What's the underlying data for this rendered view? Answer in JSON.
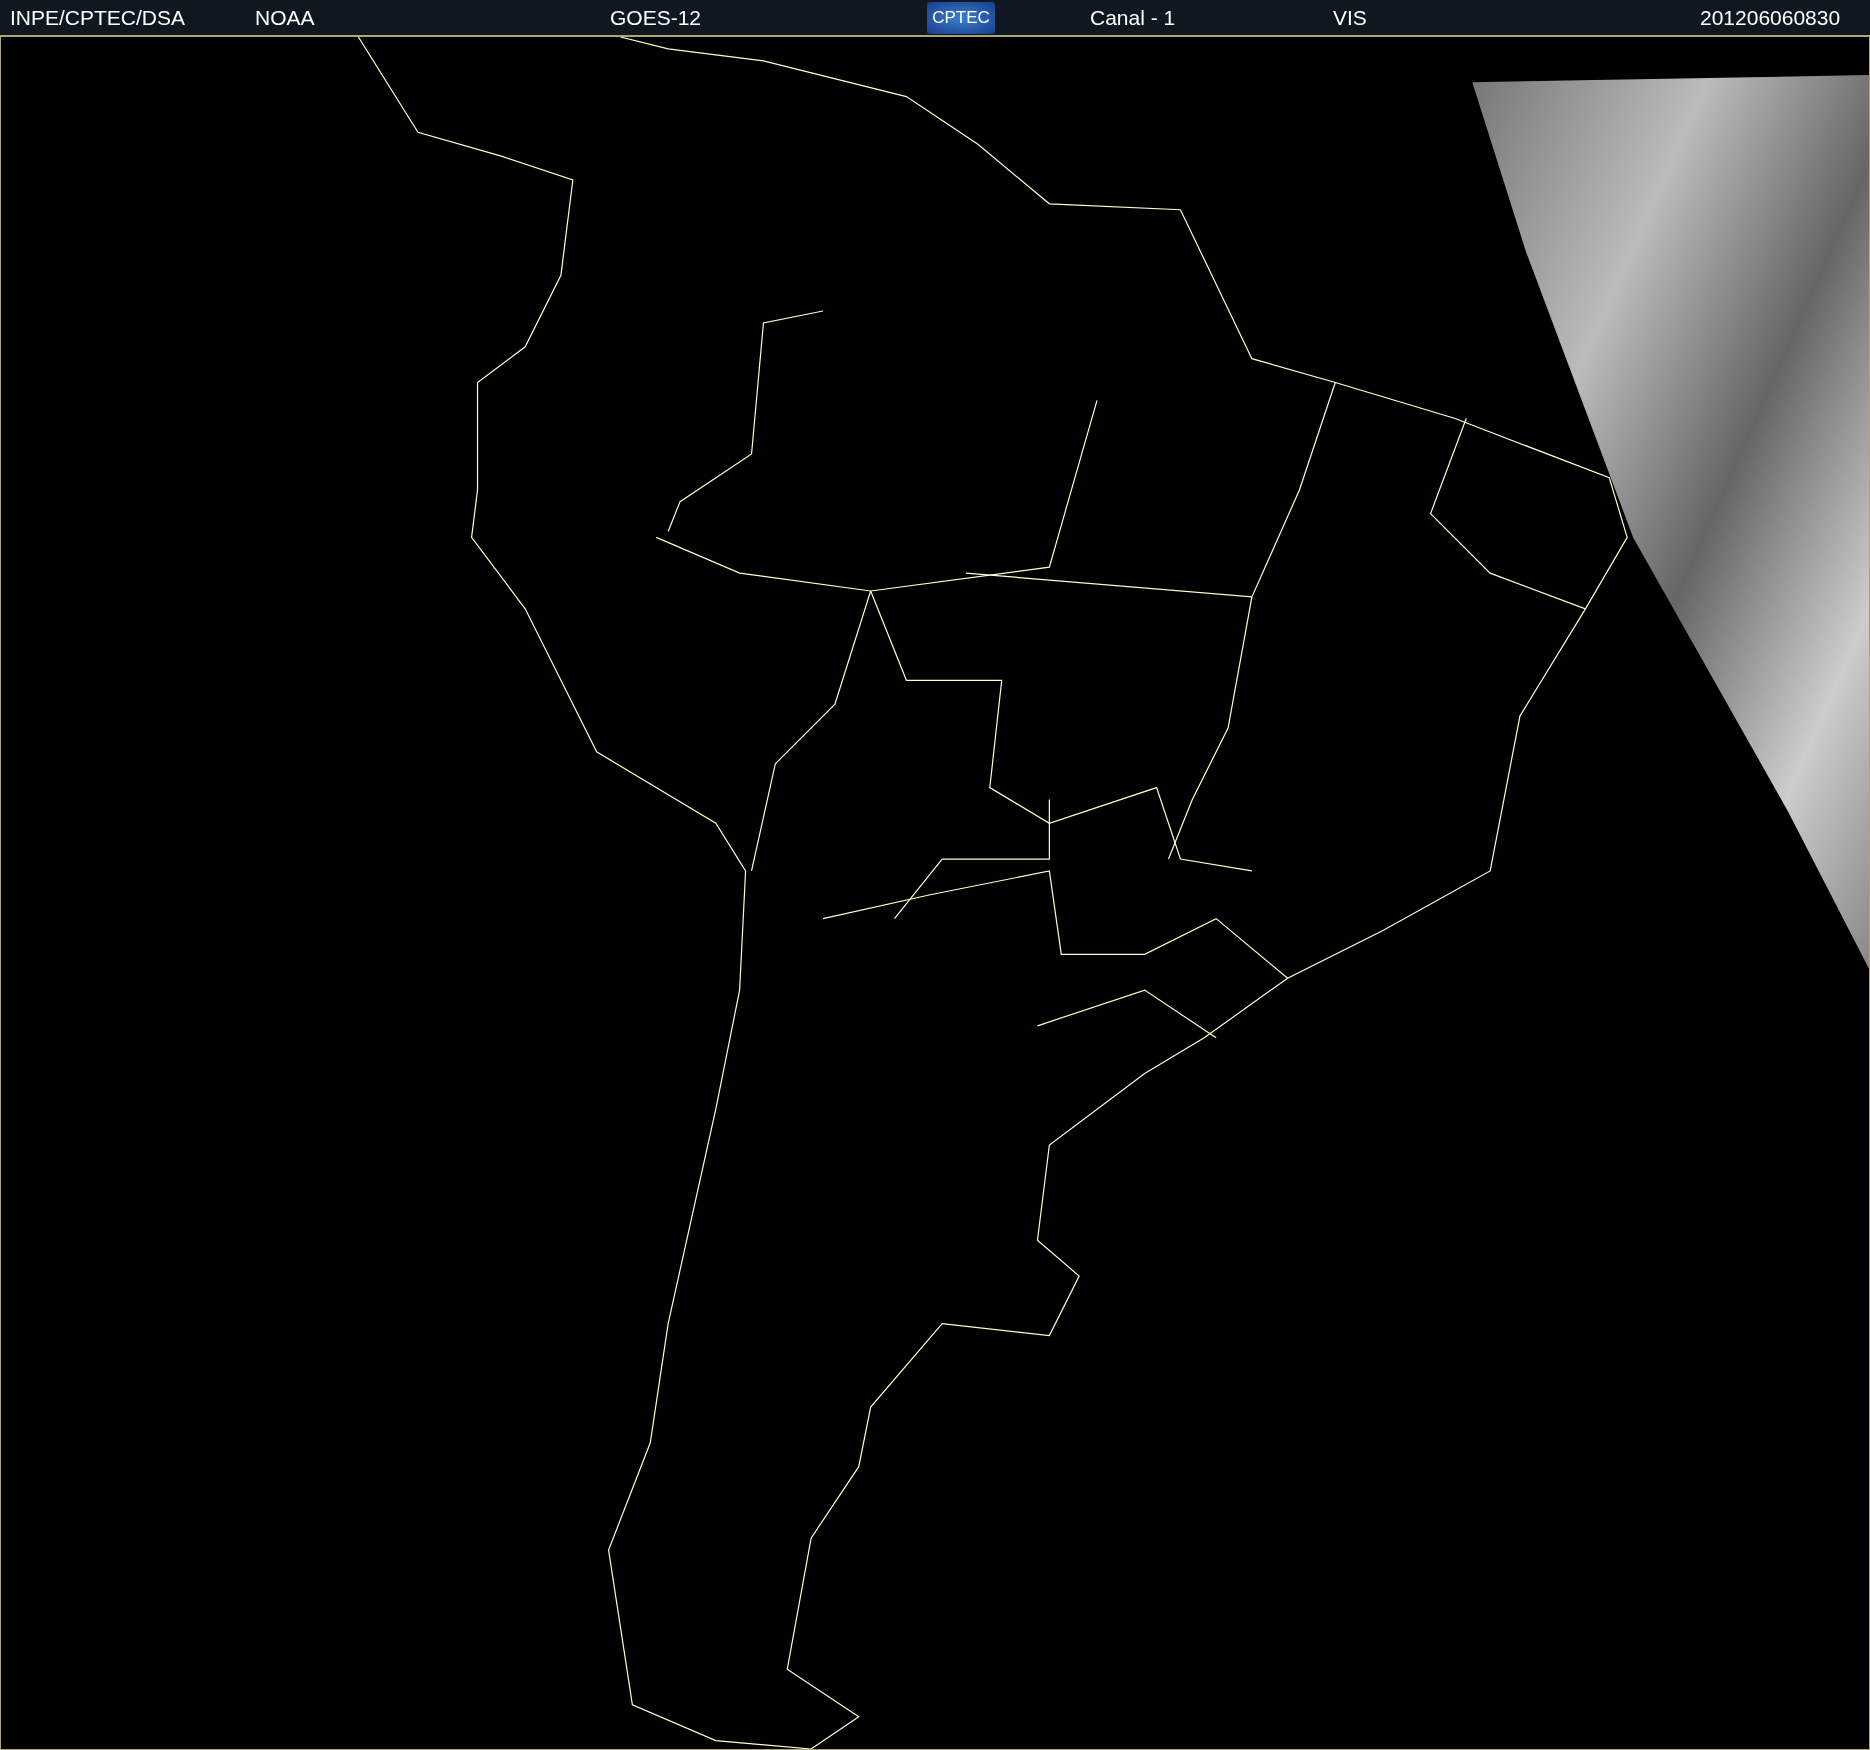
{
  "header": {
    "source": "INPE/CPTEC/DSA",
    "agency": "NOAA",
    "satellite": "GOES-12",
    "logo_text": "CPTEC",
    "channel": "Canal - 1",
    "band": "VIS",
    "timestamp": "201206060830"
  }
}
